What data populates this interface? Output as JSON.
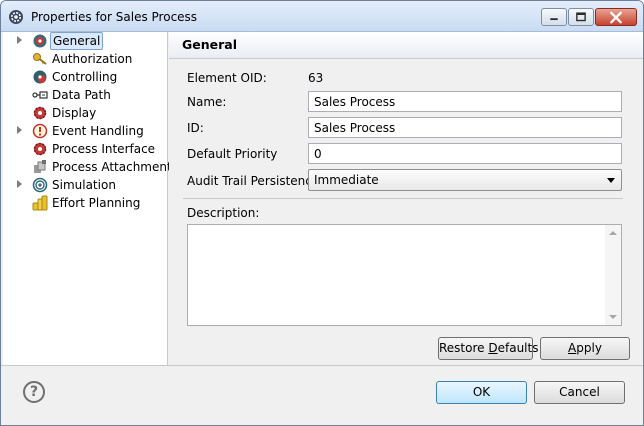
{
  "window": {
    "title": "Properties for Sales Process"
  },
  "tree": {
    "items": [
      {
        "label": "General",
        "icon": "gear-icon",
        "expandable": true,
        "selected": true
      },
      {
        "label": "Authorization",
        "icon": "key-icon",
        "expandable": false
      },
      {
        "label": "Controlling",
        "icon": "gear-icon",
        "expandable": false
      },
      {
        "label": "Data Path",
        "icon": "data-path-icon",
        "expandable": false
      },
      {
        "label": "Display",
        "icon": "gear-icon",
        "expandable": false
      },
      {
        "label": "Event Handling",
        "icon": "warning-icon",
        "expandable": true
      },
      {
        "label": "Process Interface",
        "icon": "gear-icon",
        "expandable": false
      },
      {
        "label": "Process Attachments",
        "icon": "attachment-icon",
        "expandable": false
      },
      {
        "label": "Simulation",
        "icon": "spiral-icon",
        "expandable": true
      },
      {
        "label": "Effort Planning",
        "icon": "coins-icon",
        "expandable": false
      }
    ]
  },
  "panel": {
    "title": "General",
    "element_oid_label": "Element OID:",
    "element_oid_value": "63",
    "name_label": "Name:",
    "name_value": "Sales Process",
    "id_label": "ID:",
    "id_value": "Sales Process",
    "priority_label": "Default Priority",
    "priority_value": "0",
    "audit_label": "Audit Trail Persistence",
    "audit_value": "Immediate",
    "description_label": "Description:",
    "description_value": "",
    "restore_defaults_label_pre": "Restore ",
    "restore_defaults_label_u": "D",
    "restore_defaults_label_post": "efaults",
    "apply_label_u": "A",
    "apply_label_post": "pply"
  },
  "footer": {
    "help_glyph": "?",
    "ok_label": "OK",
    "cancel_label": "Cancel"
  },
  "colors": {
    "selection_bg": "#d9e8fb",
    "selection_border": "#7da2ce",
    "ok_border": "#3c7fb1"
  }
}
